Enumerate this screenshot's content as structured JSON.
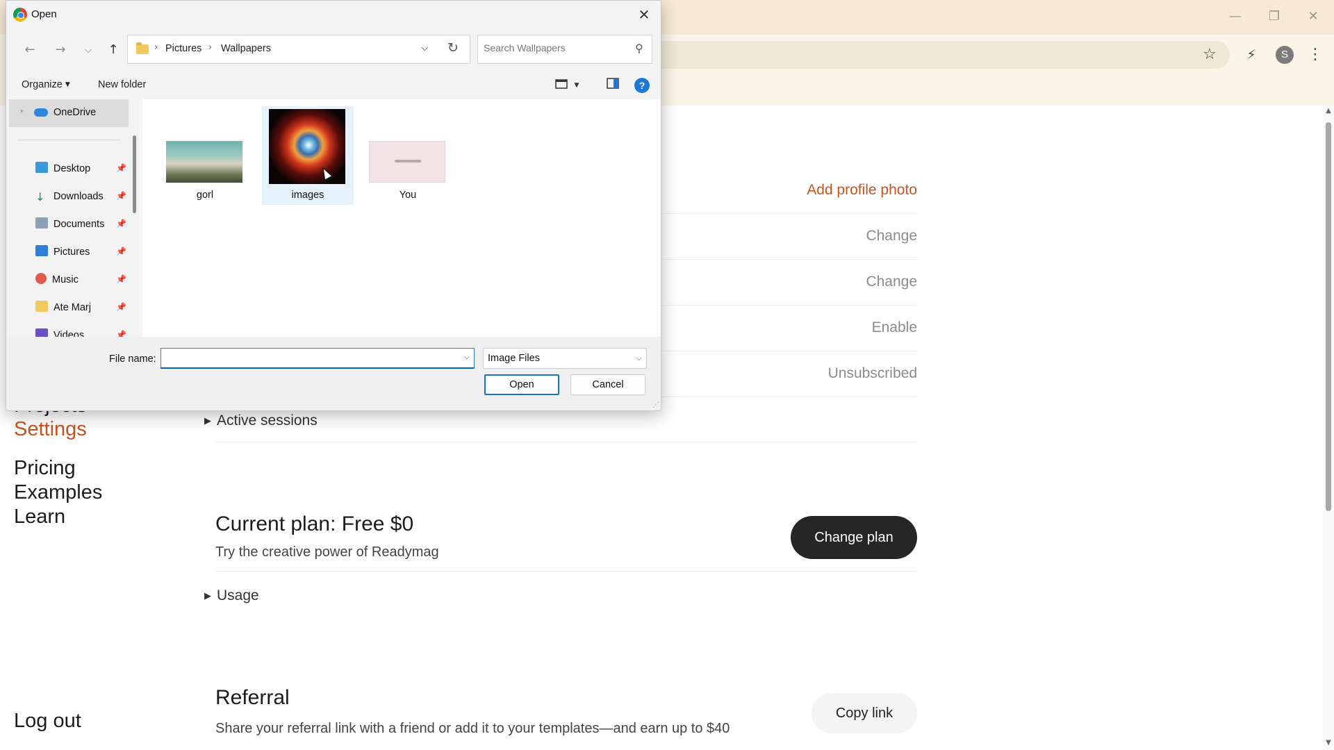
{
  "window": {
    "minimize": "—",
    "restore": "❐",
    "close": "✕"
  },
  "chrome": {
    "bookmark_icon": "☆",
    "extension_icon": "⚡",
    "avatar_letter": "S",
    "menu_icon": "⋮"
  },
  "page": {
    "nav": {
      "projects": "Projects",
      "settings": "Settings",
      "pricing": "Pricing",
      "examples": "Examples",
      "learn": "Learn",
      "logout": "Log out"
    },
    "rows": [
      {
        "action": "Add profile photo"
      },
      {
        "action": "Change"
      },
      {
        "action": "Change"
      },
      {
        "action": "Enable"
      },
      {
        "action": "Unsubscribed"
      }
    ],
    "active_sessions": "Active sessions",
    "plan": {
      "title": "Current plan: Free $0",
      "subtitle": "Try the creative power of Readymag",
      "button": "Change plan"
    },
    "usage": "Usage",
    "referral": {
      "title": "Referral",
      "subtitle": "Share your referral link with a friend or add it to your templates—and earn up to $40",
      "button": "Copy link"
    }
  },
  "dialog": {
    "title": "Open",
    "close_icon": "✕",
    "nav": {
      "back": "←",
      "forward": "→",
      "recent": "⌵",
      "up": "↑"
    },
    "breadcrumb": [
      "Pictures",
      "Wallpapers"
    ],
    "breadcrumb_sep": "›",
    "dropdown_icon": "⌵",
    "refresh_icon": "↻",
    "search_placeholder": "Search Wallpapers",
    "search_icon": "⚲",
    "organize": "Organize",
    "new_folder": "New folder",
    "help": "?",
    "nav_pane": {
      "onedrive": "OneDrive",
      "items": [
        "Desktop",
        "Downloads",
        "Documents",
        "Pictures",
        "Music",
        "Ate Marj",
        "Videos"
      ],
      "pin": "📌"
    },
    "files": [
      {
        "name": "gorl",
        "selected": false
      },
      {
        "name": "images",
        "selected": true
      },
      {
        "name": "You",
        "selected": false
      }
    ],
    "file_name_label": "File name:",
    "file_name_value": "",
    "file_type": "Image Files",
    "open_button": "Open",
    "cancel_button": "Cancel"
  },
  "colors": {
    "accent": "#c9531e",
    "dark_button": "#262626",
    "selection": "#e5f1fb",
    "dialog_blue": "#1670d0"
  }
}
